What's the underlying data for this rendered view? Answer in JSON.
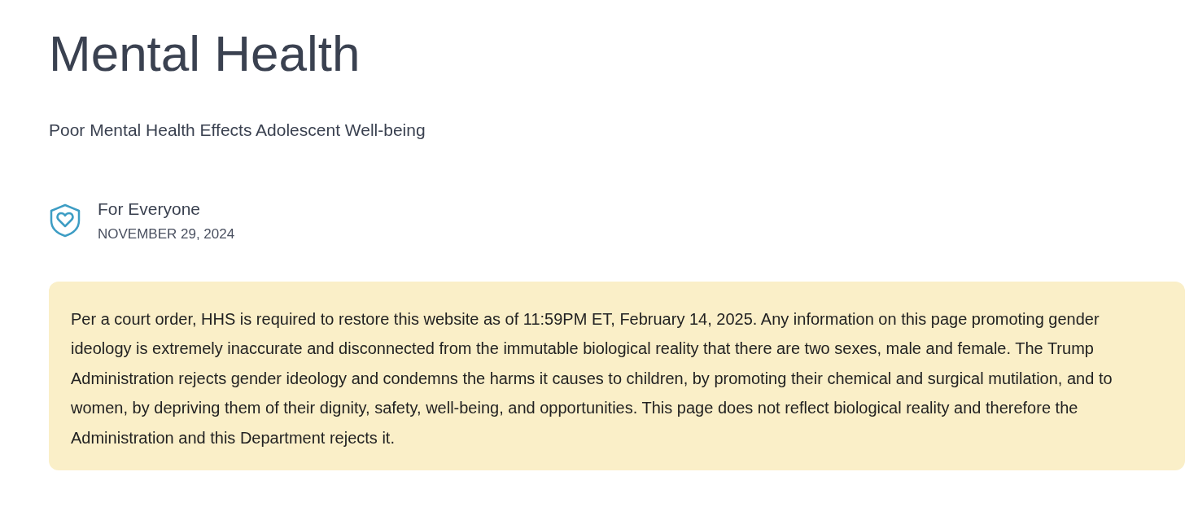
{
  "title": "Mental Health",
  "subtitle": "Poor Mental Health Effects Adolescent Well-being",
  "audience": "For Everyone",
  "date": "NOVEMBER 29, 2024",
  "notice": "Per a court order, HHS is required to restore this website as of 11:59PM ET, February 14, 2025. Any information on this page promoting gender ideology is extremely inaccurate and disconnected from the immutable biological reality that there are two sexes, male and female. The Trump Administration rejects gender ideology and condemns the harms it causes to children, by promoting their chemical and surgical mutilation, and to women, by depriving them of their dignity, safety, well-being, and opportunities. This page does not reflect biological reality and therefore the Administration and this Department rejects it."
}
